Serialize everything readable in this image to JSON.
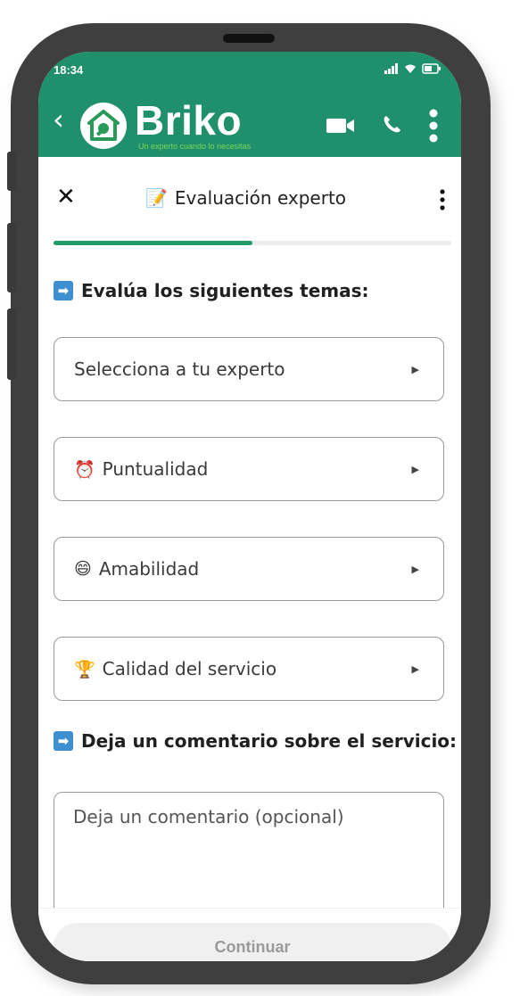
{
  "status_bar": {
    "time": "18:34"
  },
  "header": {
    "back_glyph": "‹",
    "brand": "Briko",
    "tagline": "Un experto cuando lo necesitas",
    "icons": [
      "back-icon",
      "logo-wrench-icon",
      "video-call-icon",
      "phone-icon",
      "overflow-menu-icon"
    ],
    "accent_color": "#1f8f6c"
  },
  "panel": {
    "close_glyph": "✕",
    "title_emoji": "📝",
    "title": "Evaluación experto",
    "progress": 0.5
  },
  "sections": {
    "topics_heading": "Evalúa los siguientes temas:",
    "comment_heading": "Deja un comentario sobre el servicio:",
    "arrow_glyph": "➡"
  },
  "selects": [
    {
      "emoji": "",
      "label": "Selecciona a tu experto"
    },
    {
      "emoji": "⏰",
      "label": "Puntualidad"
    },
    {
      "emoji": "😄",
      "label": "Amabilidad"
    },
    {
      "emoji": "🏆",
      "label": "Calidad del servicio"
    }
  ],
  "comment": {
    "placeholder": "Deja un comentario (opcional)"
  },
  "footer": {
    "continue_label": "Continuar"
  }
}
